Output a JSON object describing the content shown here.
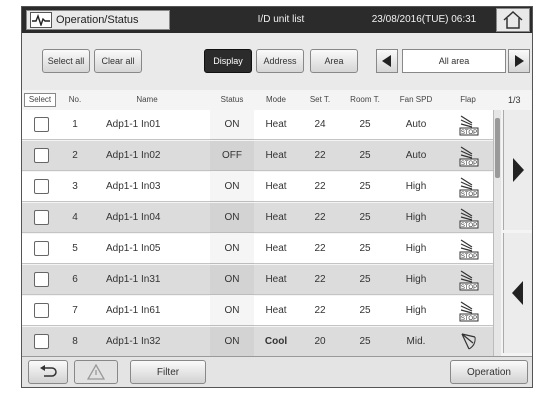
{
  "header": {
    "app_title": "Operation/Status",
    "screen_title": "I/D unit list",
    "datetime": "23/08/2016(TUE) 06:31",
    "app_icon": "pulse-icon",
    "home_icon": "home-icon"
  },
  "toolbar": {
    "select_all": "Select all",
    "clear_all": "Clear all",
    "views": [
      "Display",
      "Address",
      "Area"
    ],
    "active_view": "Display",
    "area_value": "All area"
  },
  "table": {
    "select_header": "Select",
    "columns": [
      "No.",
      "Name",
      "Status",
      "Mode",
      "Set T.",
      "Room T.",
      "Fan SPD",
      "Flap"
    ],
    "page": "1/3",
    "flap_icon_text": "STOP",
    "rows": [
      {
        "no": "1",
        "name": "Adp1-1 In01",
        "status": "ON",
        "mode": "Heat",
        "set_t": "24",
        "room_t": "25",
        "fan": "Auto",
        "flap": "stop"
      },
      {
        "no": "2",
        "name": "Adp1-1 In02",
        "status": "OFF",
        "mode": "Heat",
        "set_t": "22",
        "room_t": "25",
        "fan": "Auto",
        "flap": "stop"
      },
      {
        "no": "3",
        "name": "Adp1-1 In03",
        "status": "ON",
        "mode": "Heat",
        "set_t": "22",
        "room_t": "25",
        "fan": "High",
        "flap": "stop"
      },
      {
        "no": "4",
        "name": "Adp1-1 In04",
        "status": "ON",
        "mode": "Heat",
        "set_t": "22",
        "room_t": "25",
        "fan": "High",
        "flap": "stop"
      },
      {
        "no": "5",
        "name": "Adp1-1 In05",
        "status": "ON",
        "mode": "Heat",
        "set_t": "22",
        "room_t": "25",
        "fan": "High",
        "flap": "stop"
      },
      {
        "no": "6",
        "name": "Adp1-1 In31",
        "status": "ON",
        "mode": "Heat",
        "set_t": "22",
        "room_t": "25",
        "fan": "High",
        "flap": "stop"
      },
      {
        "no": "7",
        "name": "Adp1-1 In61",
        "status": "ON",
        "mode": "Heat",
        "set_t": "22",
        "room_t": "25",
        "fan": "High",
        "flap": "stop"
      },
      {
        "no": "8",
        "name": "Adp1-1 In32",
        "status": "ON",
        "mode": "Cool",
        "set_t": "20",
        "room_t": "25",
        "fan": "Mid.",
        "flap": "swing"
      }
    ]
  },
  "footer": {
    "back_icon": "back-arrow-icon",
    "warning_icon": "warning-icon",
    "filter": "Filter",
    "operation": "Operation"
  }
}
